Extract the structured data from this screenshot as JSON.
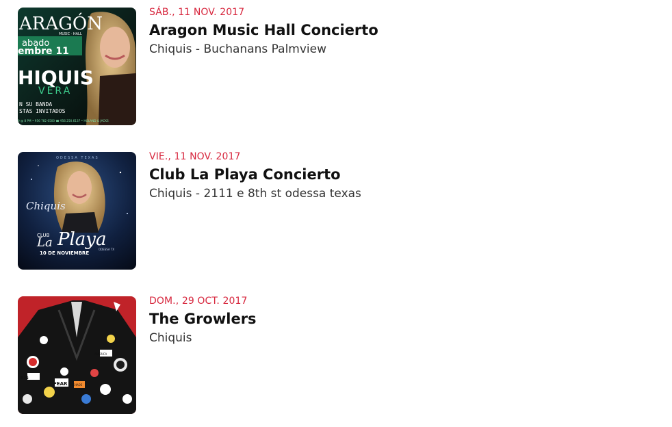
{
  "events": [
    {
      "date": "SÁB., 11 NOV. 2017",
      "title": "Aragon Music Hall Concierto",
      "subtitle": "Chiquis - Buchanans Palmview",
      "poster": {
        "venue_text": "ARAGÓN",
        "venue_sub": "MUSIC · HALL",
        "day_text": "abado",
        "date_text": "embre 11",
        "artist_text": "HIQUIS",
        "artist_sub": "VERA",
        "extra_lines": [
          "N SU BANDA",
          "STAS INVITADOS"
        ],
        "footer_text": "9 @ 8 PM • 956 782 6500  ☎ 956.250.6137 • HOLAND & JACKS"
      }
    },
    {
      "date": "VIE., 11 NOV. 2017",
      "title": "Club La Playa Concierto",
      "subtitle": "Chiquis - 2111 e 8th st odessa texas",
      "poster": {
        "top_text": "ODESSA TEXAS",
        "artist_script": "Chiquis",
        "club_text": "CLUB",
        "la_text": "La",
        "playa_text": "Playa",
        "city_text": "ODESSA TX",
        "date_text": "10 DE NOVIEMBRE"
      }
    },
    {
      "date": "DOM., 29 OCT. 2017",
      "title": "The Growlers",
      "subtitle": "Chiquis",
      "poster": {
        "patch_texts": [
          "FEAR",
          "BIG",
          "AMERICA",
          "CHAOS"
        ]
      }
    }
  ],
  "colors": {
    "date": "#d7263d",
    "title": "#111111",
    "subtitle": "#333333"
  }
}
